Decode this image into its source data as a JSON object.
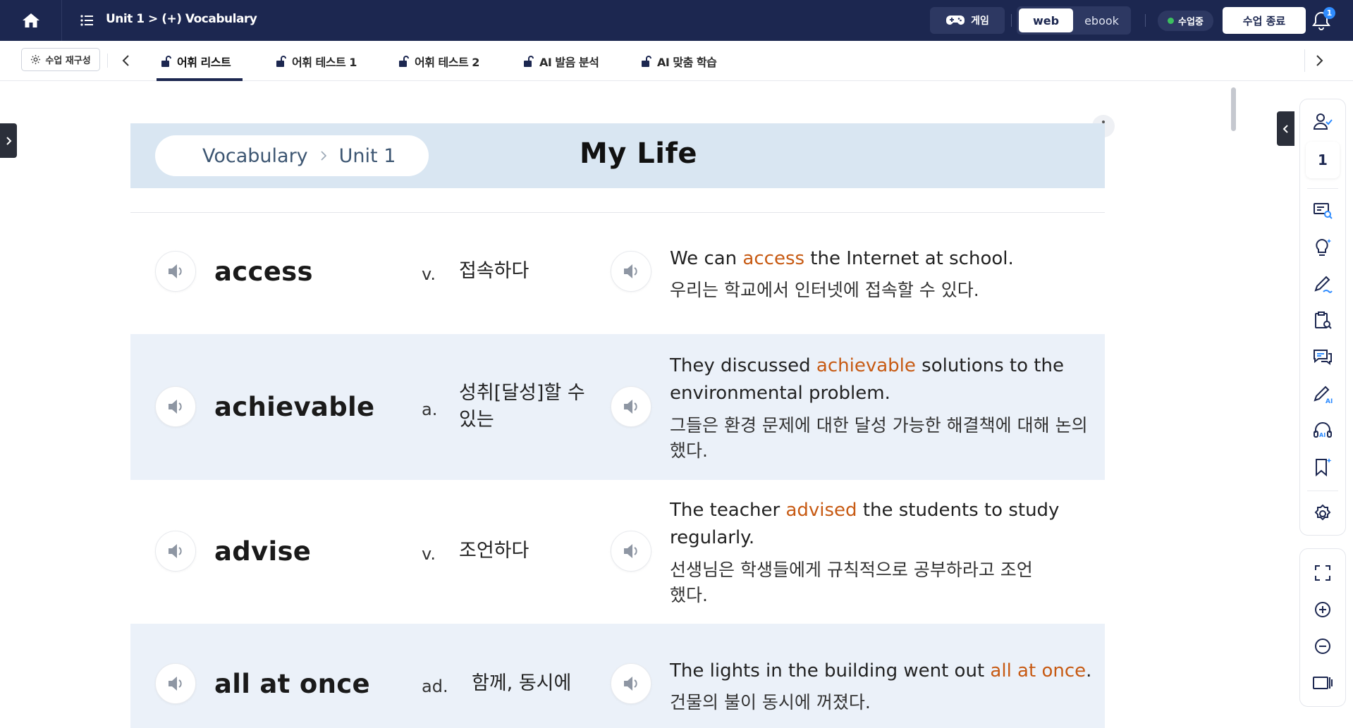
{
  "topbar": {
    "breadcrumb": "Unit 1 > (+) Vocabulary",
    "game_label": "게임",
    "view_options": [
      "web",
      "ebook"
    ],
    "active_view": "web",
    "status": "수업중",
    "end_class_label": "수업 종료",
    "notification_count": "1"
  },
  "tabbar": {
    "reconfig_label": "수업 재구성",
    "tabs": [
      {
        "label": "어휘 리스트",
        "active": true
      },
      {
        "label": "어휘 테스트 1",
        "active": false
      },
      {
        "label": "어휘 테스트 2",
        "active": false
      },
      {
        "label": "AI 발음 분석",
        "active": false
      },
      {
        "label": "AI 맞춤 학습",
        "active": false
      }
    ]
  },
  "header": {
    "crumb_section": "Vocabulary",
    "crumb_unit": "Unit 1",
    "title": "My Life"
  },
  "vocab": [
    {
      "word": "access",
      "pos": "v.",
      "meaning": "접속하다",
      "example_pre": "We can ",
      "example_hl": "access",
      "example_post": " the Internet at school.",
      "translation": "우리는 학교에서 인터넷에 접속할 수 있다."
    },
    {
      "word": "achievable",
      "pos": "a.",
      "meaning": "성취[달성]할 수 있는",
      "example_pre": "They discussed ",
      "example_hl": "achievable",
      "example_post": " solutions to the environmental problem.",
      "translation": "그들은 환경 문제에 대한 달성 가능한 해결책에 대해 논의했다."
    },
    {
      "word": "advise",
      "pos": "v.",
      "meaning": "조언하다",
      "example_pre": "The teacher ",
      "example_hl": "advised",
      "example_post": " the students to study regularly.",
      "translation": "선생님은 학생들에게 규칙적으로 공부하라고 조언했다."
    },
    {
      "word": "all at once",
      "pos": "ad.",
      "meaning": "함께, 동시에",
      "example_pre": "The lights in the building went out ",
      "example_hl": "all at once",
      "example_post": ".",
      "translation": "건물의 불이 동시에 꺼졌다."
    }
  ],
  "side_panel": {
    "student_count": "1"
  },
  "colors": {
    "topbar": "#1c2750",
    "header_band": "#d9e6f2",
    "alt_row": "#ebf1f9",
    "highlight": "#c75a13",
    "status_dot": "#3cc05f"
  }
}
